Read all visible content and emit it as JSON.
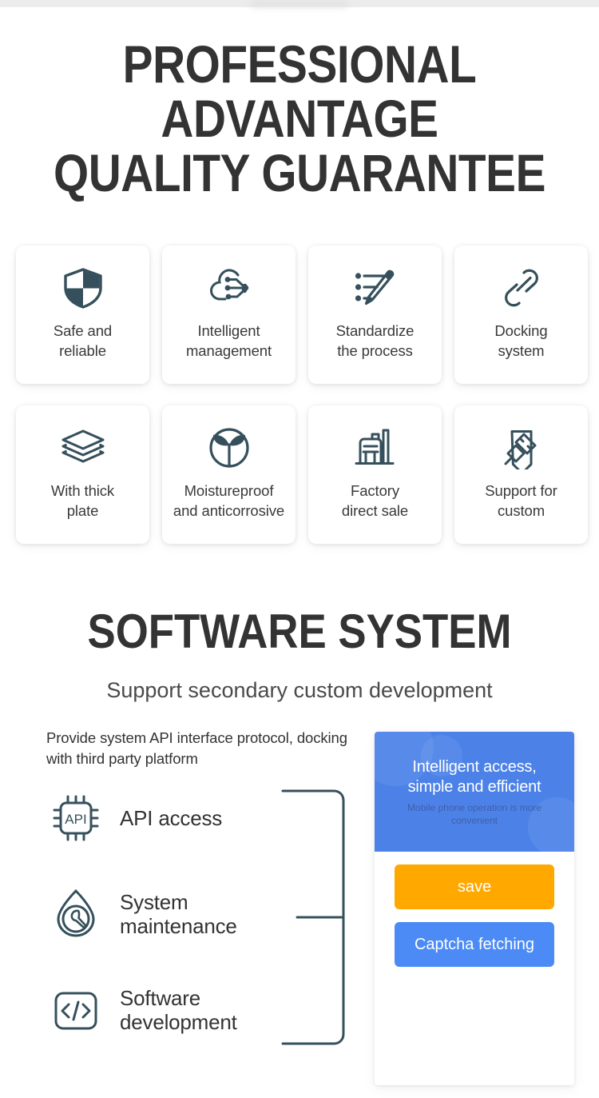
{
  "hero": {
    "title_lines": [
      "PROFESSIONAL",
      "ADVANTAGE",
      "QUALITY GUARANTEE"
    ]
  },
  "features": [
    {
      "icon": "shield-icon",
      "label": "Safe and\nreliable"
    },
    {
      "icon": "cloud-circuit-icon",
      "label": "Intelligent\nmanagement"
    },
    {
      "icon": "list-pencil-icon",
      "label": "Standardize\nthe process"
    },
    {
      "icon": "chain-link-icon",
      "label": "Docking\nsystem"
    },
    {
      "icon": "layers-icon",
      "label": "With thick\nplate"
    },
    {
      "icon": "sprout-circle-icon",
      "label": "Moistureproof\nand anticorrosive"
    },
    {
      "icon": "factory-icon",
      "label": "Factory\ndirect sale"
    },
    {
      "icon": "pencil-ruler-icon",
      "label": "Support for\ncustom"
    }
  ],
  "software": {
    "title": "SOFTWARE SYSTEM",
    "subtitle": "Support secondary custom development",
    "description": "Provide system API interface protocol, docking with third party platform",
    "items": [
      {
        "icon": "api-chip-icon",
        "label": "API access"
      },
      {
        "icon": "droplet-wrench-icon",
        "label": "System\nmaintenance"
      },
      {
        "icon": "code-brackets-icon",
        "label": "Software\ndevelopment"
      }
    ]
  },
  "phone": {
    "banner_title": "Intelligent access,\nsimple and efficient",
    "banner_subtitle": "Mobile phone operation is more convenient",
    "save_label": "save",
    "captcha_label": "Captcha fetching"
  },
  "colors": {
    "icon": "#35505c",
    "heading": "#333333",
    "label": "#3a3a3a",
    "banner_blue": "#4c82e8",
    "button_orange": "#ffa800",
    "button_blue": "#4c8bf5",
    "top_strip": "#ececec"
  }
}
